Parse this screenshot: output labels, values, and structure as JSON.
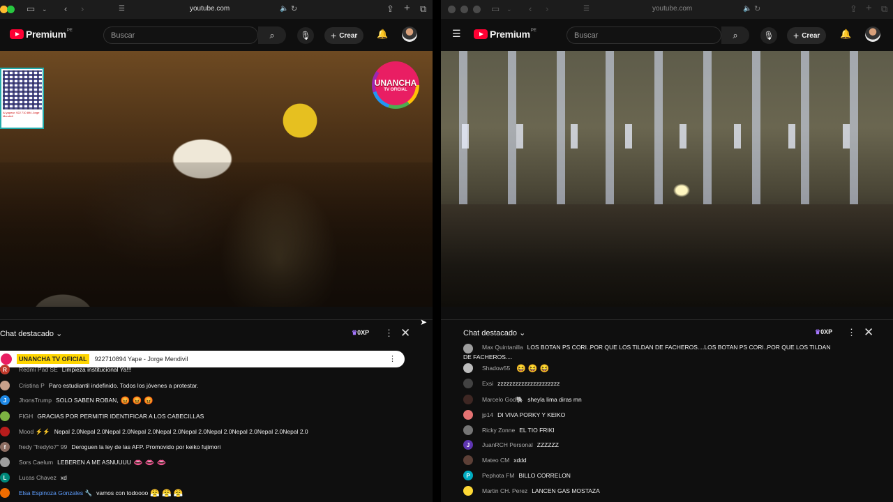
{
  "left": {
    "url": "youtube.com",
    "logo_text": "Premium",
    "logo_region": "PE",
    "search_placeholder": "Buscar",
    "create_label": "Crear",
    "video_overlay": {
      "badge_line1": "UNANCHA",
      "badge_line2": "TV OFICIAL",
      "qr_caption": "Al yapear: 922 710 894 Jorge Mendivil"
    },
    "chat": {
      "title": "Chat destacado",
      "xp": "0XP",
      "pinned": {
        "name": "UNANCHA TV OFICIAL",
        "text": "922710894 Yape - Jorge Mendivil"
      },
      "messages": [
        {
          "name": "Redmi Pad SE",
          "text": "Limpieza institucional Ya!!!",
          "initial": "R",
          "color": "#c0392b"
        },
        {
          "name": "Cristina P",
          "text": "Paro estudiantil indefinido. Todos los jóvenes a protestar.",
          "initial": "",
          "color": "#c8a08a"
        },
        {
          "name": "JhonsTrump",
          "text": "SOLO SABEN ROBAN,",
          "emoji": "😡 😡 😡",
          "initial": "J",
          "color": "#1e88e5"
        },
        {
          "name": "FIGH",
          "text": "GRACIAS POR PERMITIR IDENTIFICAR A LOS CABECILLAS",
          "initial": "",
          "color": "#7cb342"
        },
        {
          "name": "Mood ⚡⚡",
          "text": "Nepal 2.0Nepal 2.0Nepal 2.0Nepal 2.0Nepal 2.0Nepal 2.0Nepal 2.0Nepal 2.0Nepal 2.0Nepal 2.0",
          "initial": "",
          "color": "#b71c1c"
        },
        {
          "name": "fredy \"fredylo7\" 99",
          "text": "Deroguen la ley de las AFP. Promovido por keiko fujimori",
          "initial": "f",
          "color": "#8d6e63"
        },
        {
          "name": "Sors Caelum",
          "text": "LEBEREN A ME ASNUUUU",
          "emoji": "👄 👄 👄",
          "initial": "",
          "color": "#9e9e9e"
        },
        {
          "name": "Lucas Chavez",
          "text": "xd",
          "initial": "L",
          "color": "#00897b"
        },
        {
          "name": "Elsa Espinoza Gonzales 🔧",
          "text": "vamos con todoooo",
          "emoji": "😤 😤 😤",
          "initial": "",
          "color": "#ef6c00",
          "highlight": true
        }
      ]
    }
  },
  "right": {
    "url": "youtube.com",
    "logo_text": "Premium",
    "logo_region": "PE",
    "search_placeholder": "Buscar",
    "create_label": "Crear",
    "chat": {
      "title": "Chat destacado",
      "xp": "0XP",
      "messages": [
        {
          "name": "Max Quintanilla",
          "text": "LOS BOTAN PS CORI..POR QUE LOS TILDAN DE FACHEROS....LOS BOTAN PS CORI..POR QUE LOS TILDAN DE FACHEROS....",
          "initial": "",
          "color": "#9e9e9e",
          "wrap": true
        },
        {
          "name": "Shadow55",
          "text": "",
          "emoji": "😆 😆 😆",
          "initial": "",
          "color": "#bdbdbd"
        },
        {
          "name": "Exsi",
          "text": "zzzzzzzzzzzzzzzzzzzzz",
          "initial": "",
          "color": "#424242"
        },
        {
          "name": "Marcelo God🐘",
          "text": "sheyla lima diras mn",
          "initial": "",
          "color": "#3e2723"
        },
        {
          "name": "jp14",
          "text": "DI VIVA PORKY Y KEIKO",
          "initial": "",
          "color": "#e57373"
        },
        {
          "name": "Ricky Zonne",
          "text": "EL TIO FRIKI",
          "initial": "",
          "color": "#757575"
        },
        {
          "name": "JuanRCH Personal",
          "text": "ZZZZZZ",
          "initial": "J",
          "color": "#5e35b1"
        },
        {
          "name": "Mateo CM",
          "text": "xddd",
          "initial": "",
          "color": "#5d4037"
        },
        {
          "name": "Pephota FM",
          "text": "BILLO CORRELON",
          "initial": "P",
          "color": "#00acc1"
        },
        {
          "name": "Martin CH. Perez",
          "text": "LANCEN GAS MOSTAZA",
          "initial": "",
          "color": "#fdd835"
        }
      ]
    }
  }
}
